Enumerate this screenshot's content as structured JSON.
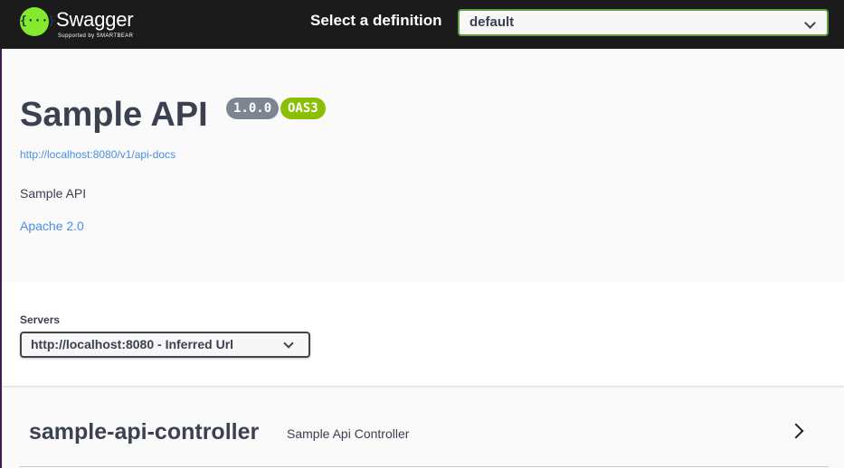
{
  "topbar": {
    "logo_symbol": "{···}",
    "logo_name": "Swagger",
    "logo_sub": "Supported by SMARTBEAR",
    "definition_label": "Select a definition",
    "definition_value": "default"
  },
  "info": {
    "title": "Sample API",
    "version": "1.0.0",
    "oas_badge": "OAS3",
    "spec_url": "http://localhost:8080/v1/api-docs",
    "description": "Sample API",
    "license": "Apache 2.0"
  },
  "servers": {
    "label": "Servers",
    "selected": "http://localhost:8080 - Inferred Url"
  },
  "tags": [
    {
      "name": "sample-api-controller",
      "description": "Sample Api Controller"
    }
  ],
  "colors": {
    "topbar_bg": "#1b1b1b",
    "brand_green": "#85ea2d",
    "oas_badge": "#89bf04",
    "version_badge": "#7d8492",
    "link": "#4990e2"
  }
}
